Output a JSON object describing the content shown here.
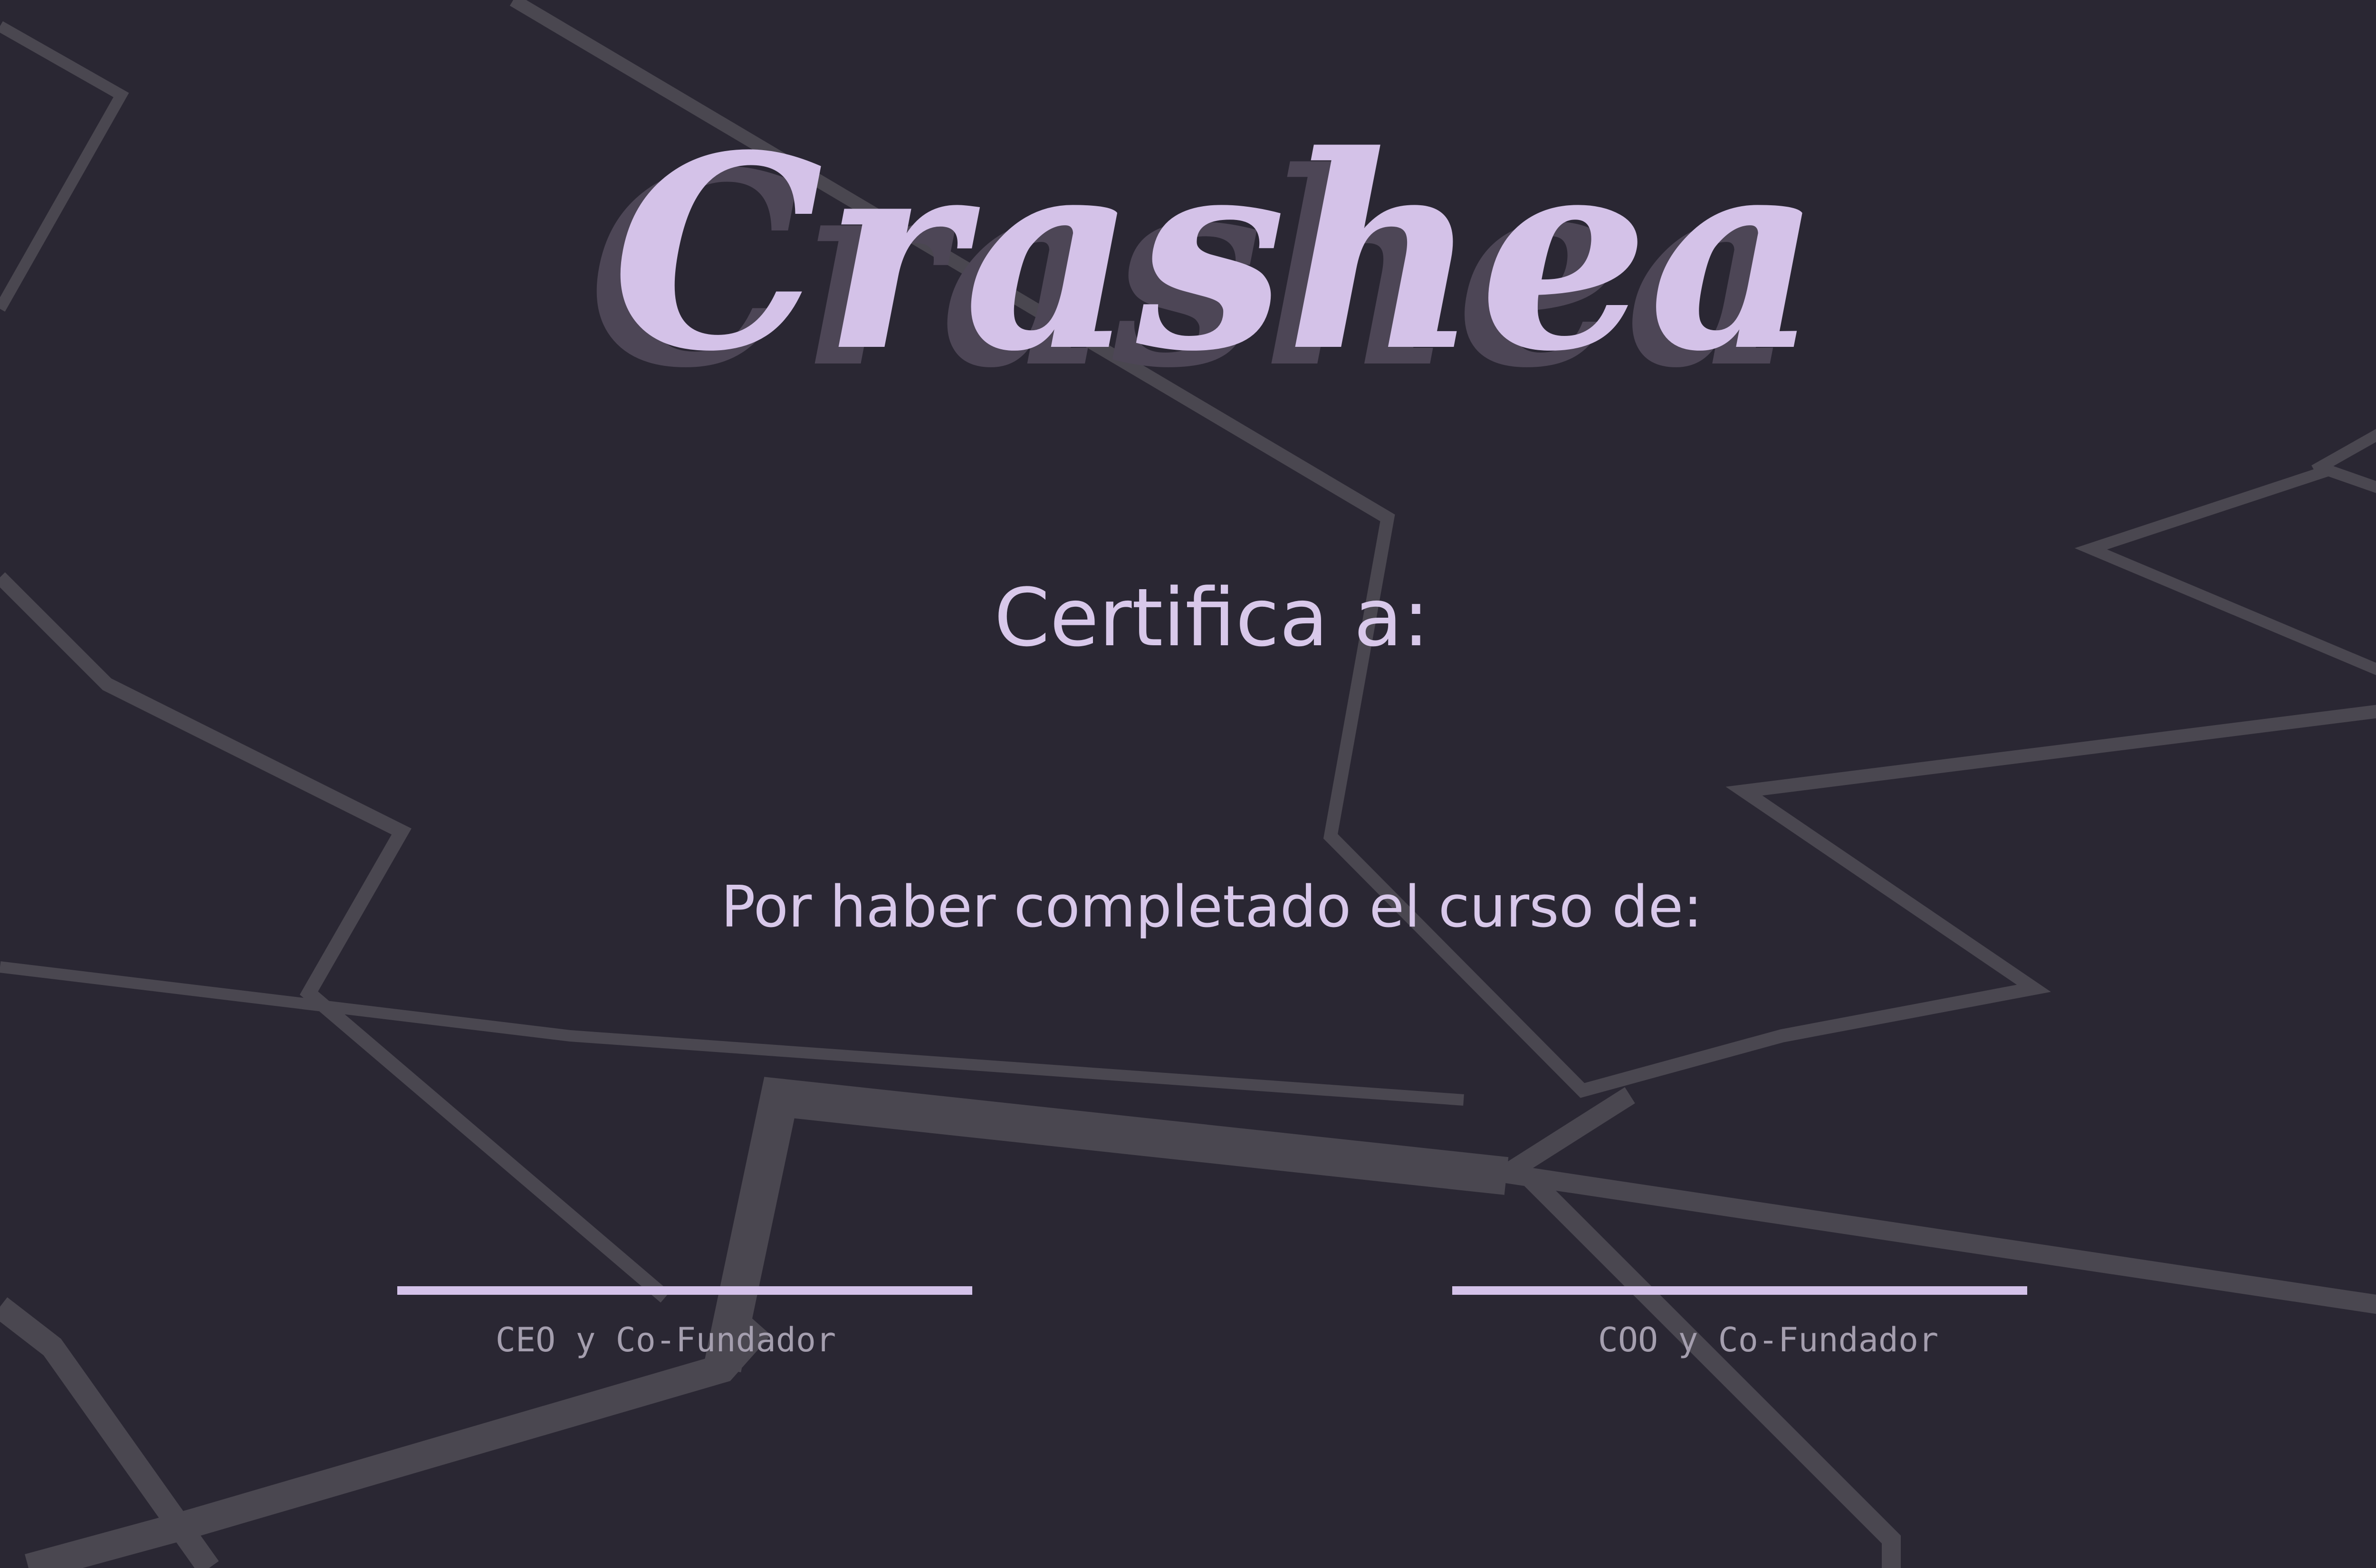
{
  "certificate": {
    "brand": "Crashea",
    "certifies_label": "Certifica a:",
    "course_label": "Por haber completado el curso de:"
  },
  "signatures": [
    {
      "title": "CEO y Co-Fundador"
    },
    {
      "title": "COO y Co-Fundador"
    }
  ],
  "colors": {
    "background": "#2a2733",
    "accent": "#d8c8ea",
    "decor_lines": "#4a4750",
    "signature_text": "#a49eae"
  }
}
